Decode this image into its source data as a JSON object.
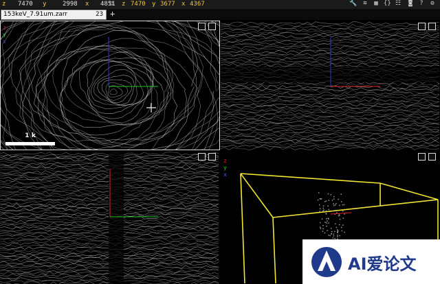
{
  "toolbar": {
    "left_coords": {
      "z_label": "z",
      "z": "7470",
      "y_label": "y",
      "y": "2998",
      "x_label": "x",
      "x": "4851"
    },
    "right_coords": {
      "z_label": "z",
      "z": "7470",
      "y_label": "y",
      "y": "3677",
      "x_label": "x",
      "x": "4367"
    },
    "icons": [
      "wrench-icon",
      "layers-icon",
      "layout-icon",
      "braces-icon",
      "settings-icon",
      "camera-icon",
      "help-icon",
      "gear-icon"
    ]
  },
  "tabs": [
    {
      "label": "153keV_7.91um.zarr",
      "count": "23"
    }
  ],
  "tab_add": "+",
  "panels": {
    "xy": {
      "scale_label": "1 k",
      "legend": [
        "z",
        "y",
        "x"
      ]
    },
    "xz": {},
    "yz": {},
    "3d": {
      "legend": [
        "z",
        "y",
        "x"
      ]
    }
  },
  "colors": {
    "accent": "#f5c842",
    "bbox": "#f2e633",
    "axis_red": "#d22",
    "axis_green": "#2c2",
    "axis_blue": "#33c"
  },
  "watermark": {
    "text": "AI爱论文"
  }
}
